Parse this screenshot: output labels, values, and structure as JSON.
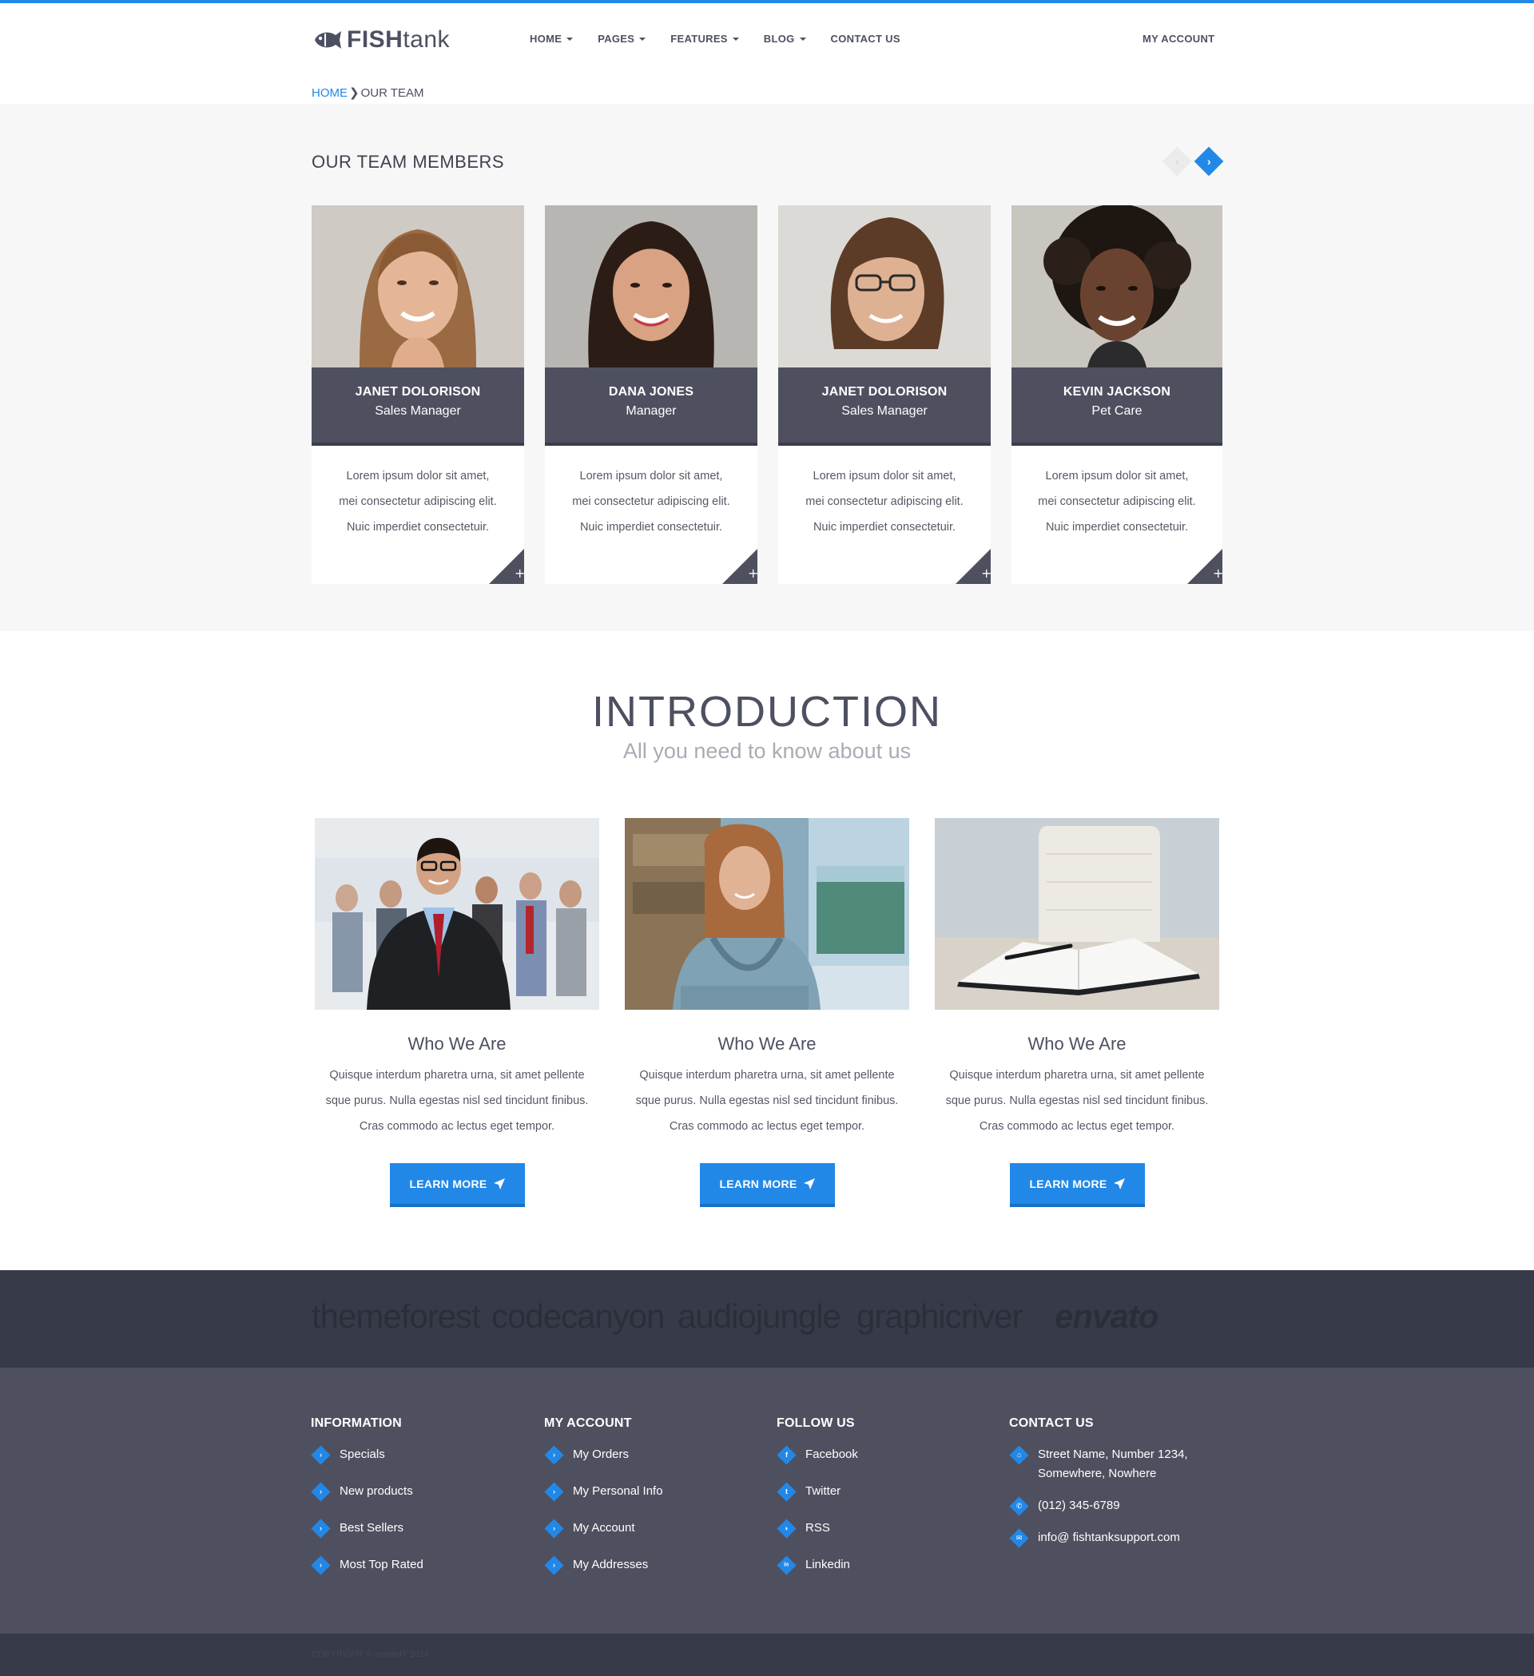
{
  "header": {
    "logo_bold": "FISH",
    "logo_light": "tank",
    "nav": [
      {
        "label": "HOME",
        "has_dropdown": true
      },
      {
        "label": "PAGES",
        "has_dropdown": true
      },
      {
        "label": "FEATURES",
        "has_dropdown": true
      },
      {
        "label": "BLOG",
        "has_dropdown": true
      },
      {
        "label": "CONTACT US",
        "has_dropdown": false
      }
    ],
    "account_label": "MY ACCOUNT",
    "accent_color": "#2288e8"
  },
  "breadcrumb": {
    "home": "HOME",
    "separator": "❯",
    "current": "OUR TEAM"
  },
  "team": {
    "title": "OUR TEAM MEMBERS",
    "prev_icon": "chevron-left-icon",
    "next_icon": "chevron-right-icon",
    "next_glyph": "›",
    "prev_glyph": "‹",
    "members": [
      {
        "name": "JANET DOLORISON",
        "role": "Sales Manager",
        "text": [
          "Lorem ipsum dolor sit amet,",
          "mei consectetur adipiscing elit.",
          "Nuic imperdiet consectetuir."
        ],
        "expand": "+"
      },
      {
        "name": "DANA JONES",
        "role": "Manager",
        "text": [
          "Lorem ipsum dolor sit amet,",
          "mei consectetur adipiscing elit.",
          "Nuic imperdiet consectetuir."
        ],
        "expand": "+"
      },
      {
        "name": "JANET DOLORISON",
        "role": "Sales Manager",
        "text": [
          "Lorem ipsum dolor sit amet,",
          "mei consectetur adipiscing elit.",
          "Nuic imperdiet consectetuir."
        ],
        "expand": "+"
      },
      {
        "name": "KEVIN JACKSON",
        "role": "Pet Care",
        "text": [
          "Lorem ipsum dolor sit amet,",
          "mei consectetur adipiscing elit.",
          "Nuic imperdiet consectetuir."
        ],
        "expand": "+"
      }
    ]
  },
  "intro": {
    "title": "INTRODUCTION",
    "subtitle": "All you need to know about us",
    "features": [
      {
        "title": "Who We Are",
        "text": [
          "Quisque interdum pharetra urna, sit amet pellente",
          "sque purus. Nulla egestas nisl sed tincidunt finibus.",
          "Cras commodo ac lectus eget tempor."
        ],
        "button": "LEARN MORE"
      },
      {
        "title": "Who We Are",
        "text": [
          "Quisque interdum pharetra urna, sit amet pellente",
          "sque purus. Nulla egestas nisl sed tincidunt finibus.",
          "Cras commodo ac lectus eget tempor."
        ],
        "button": "LEARN MORE"
      },
      {
        "title": "Who We Are",
        "text": [
          "Quisque interdum pharetra urna, sit amet pellente",
          "sque purus. Nulla egestas nisl sed tincidunt finibus.",
          "Cras commodo ac lectus eget tempor."
        ],
        "button": "LEARN MORE"
      }
    ]
  },
  "brands": [
    "themeforest",
    "codecanyon",
    "audiojungle",
    "graphicriver",
    "envato"
  ],
  "footer": {
    "information": {
      "heading": "INFORMATION",
      "items": [
        "Specials",
        "New products",
        "Best Sellers",
        "Most Top Rated"
      ]
    },
    "my_account": {
      "heading": "MY ACCOUNT",
      "items": [
        "My Orders",
        "My Personal Info",
        "My Account",
        "My Addresses"
      ]
    },
    "follow_us": {
      "heading": "FOLLOW US",
      "items": [
        {
          "label": "Facebook",
          "icon": "facebook-icon",
          "glyph": "f"
        },
        {
          "label": "Twitter",
          "icon": "twitter-icon",
          "glyph": "t"
        },
        {
          "label": "RSS",
          "icon": "rss-icon",
          "glyph": "◗"
        },
        {
          "label": "Linkedin",
          "icon": "linkedin-icon",
          "glyph": "in"
        }
      ]
    },
    "contact_us": {
      "heading": "CONTACT US",
      "address": "Street Name, Number 1234, Somewhere, Nowhere",
      "phone": "(012) 345-6789",
      "email": "info@ fishtanksupport.com"
    },
    "copyright": "COPYRIGHT © createIT 2014"
  }
}
